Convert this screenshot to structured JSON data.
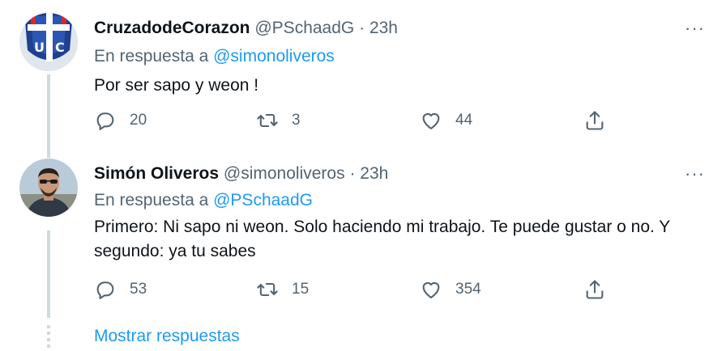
{
  "tweets": [
    {
      "name": "CruzadodeCorazon",
      "handle": "@PSchaadG",
      "sep": "·",
      "time": "23h",
      "reply_prefix": "En respuesta a",
      "reply_to": "@simonoliveros",
      "text": "Por ser sapo y weon !",
      "replies": "20",
      "retweets": "3",
      "likes": "44",
      "avatar": "uc-crest"
    },
    {
      "name": "Simón Oliveros",
      "handle": "@simonoliveros",
      "sep": "·",
      "time": "23h",
      "reply_prefix": "En respuesta a",
      "reply_to": "@PSchaadG",
      "text": "Primero: Ni sapo ni weon. Solo haciendo mi trabajo. Te puede gustar o no. Y segundo: ya tu sabes",
      "replies": "53",
      "retweets": "15",
      "likes": "354",
      "avatar": "man-sunglasses"
    }
  ],
  "show_replies_label": "Mostrar respuestas",
  "more_label": "···",
  "colors": {
    "accent": "#1d9bf0",
    "muted": "#536471",
    "line": "#cfd9de"
  }
}
